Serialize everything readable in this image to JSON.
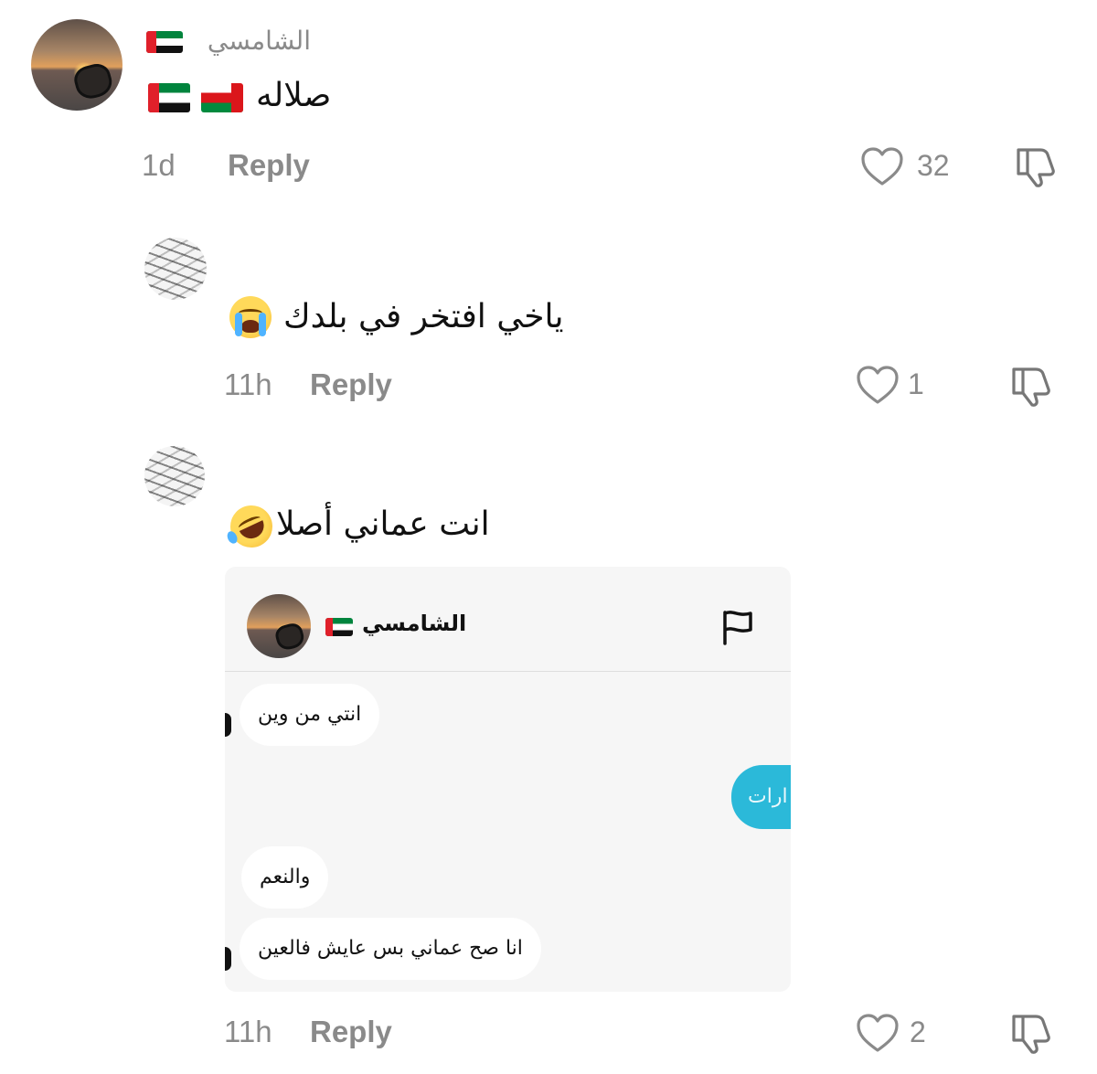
{
  "comments": [
    {
      "username": "الشامسي",
      "text": "صلاله",
      "time": "1d",
      "reply_label": "Reply",
      "likes": "32"
    },
    {
      "username": "",
      "text": "ياخي افتخر في بلدك",
      "time": "11h",
      "reply_label": "Reply",
      "likes": "1"
    },
    {
      "username": "",
      "text": "انت عماني أصلا",
      "time": "11h",
      "reply_label": "Reply",
      "likes": "2"
    }
  ],
  "attached_screenshot": {
    "username": "الشامسي",
    "messages": [
      {
        "side": "incoming",
        "text": "انتي من وين"
      },
      {
        "side": "outgoing",
        "text": "ارات"
      },
      {
        "side": "incoming",
        "text": "والنعم"
      },
      {
        "side": "incoming",
        "text": "انا صح عماني بس عايش فالعين"
      }
    ]
  },
  "colors": {
    "meta_gray": "#8a8a8a",
    "outgoing_bubble": "#2bb9d9",
    "card_background": "#f6f6f6"
  },
  "icons": {
    "like": "heart-outline-icon",
    "dislike": "thumbs-down-outline-icon",
    "report": "flag-outline-icon"
  }
}
